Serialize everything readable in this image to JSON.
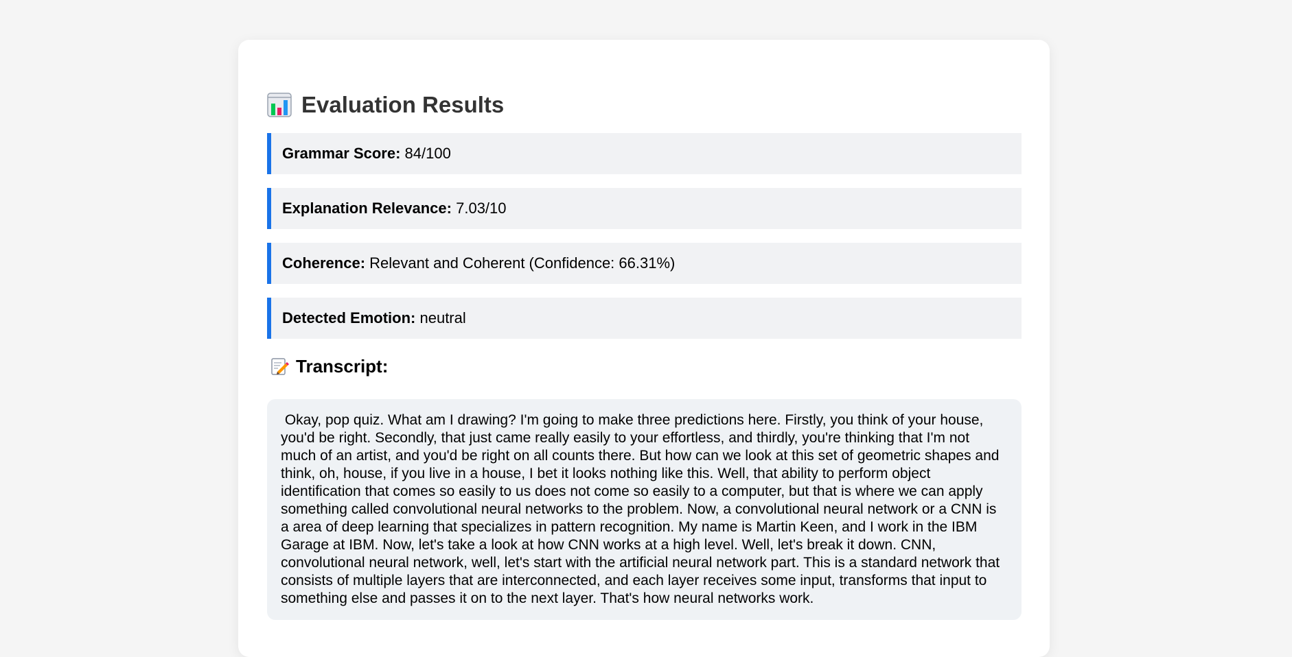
{
  "header": {
    "title": "Evaluation Results",
    "icon": "bar-chart-icon"
  },
  "metrics": [
    {
      "label": "Grammar Score:",
      "value": "84/100"
    },
    {
      "label": "Explanation Relevance:",
      "value": "7.03/10"
    },
    {
      "label": "Coherence:",
      "value": "Relevant and Coherent (Confidence: 66.31%)"
    },
    {
      "label": "Detected Emotion:",
      "value": "neutral"
    }
  ],
  "transcript": {
    "icon": "memo-icon",
    "heading": "Transcript:",
    "text": " Okay, pop quiz. What am I drawing? I'm going to make three predictions here. Firstly, you think of your house, you'd be right. Secondly, that just came really easily to your effortless, and thirdly, you're thinking that I'm not much of an artist, and you'd be right on all counts there. But how can we look at this set of geometric shapes and think, oh, house, if you live in a house, I bet it looks nothing like this. Well, that ability to perform object identification that comes so easily to us does not come so easily to a computer, but that is where we can apply something called convolutional neural networks to the problem. Now, a convolutional neural network or a CNN is a area of deep learning that specializes in pattern recognition. My name is Martin Keen, and I work in the IBM Garage at IBM. Now, let's take a look at how CNN works at a high level. Well, let's break it down. CNN, convolutional neural network, well, let's start with the artificial neural network part. This is a standard network that consists of multiple layers that are interconnected, and each layer receives some input, transforms that input to something else and passes it on to the next layer. That's how neural networks work."
  },
  "colors": {
    "accent": "#1a73e8",
    "page_bg": "#f5f5f5",
    "metric_bg": "#f1f2f4",
    "transcript_bg": "#eff2f5"
  }
}
